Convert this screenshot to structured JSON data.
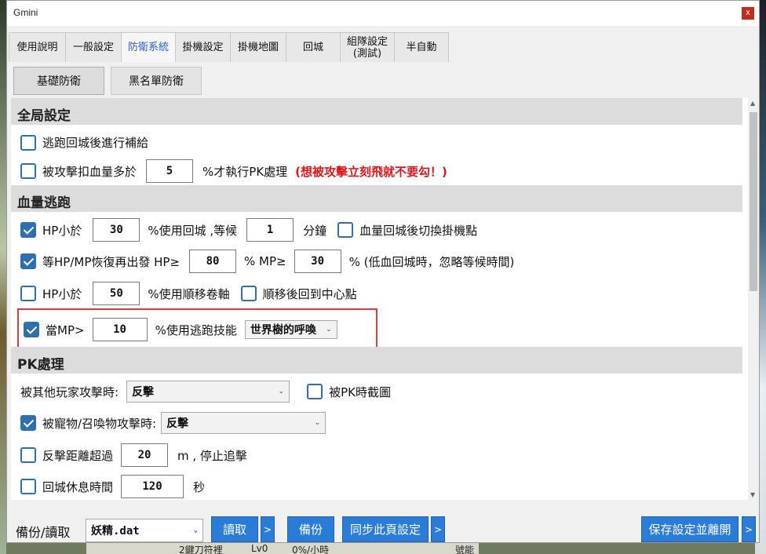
{
  "window": {
    "title": "Gmini",
    "close": "x"
  },
  "tabs": [
    {
      "label": "使用說明"
    },
    {
      "label": "一般設定"
    },
    {
      "label": "防衛系統"
    },
    {
      "label": "掛機設定"
    },
    {
      "label": "掛機地圖"
    },
    {
      "label": "回城"
    },
    {
      "label": "組隊設定\n(測試)"
    },
    {
      "label": "半自動"
    }
  ],
  "subtabs": [
    {
      "label": "基礎防衛"
    },
    {
      "label": "黑名單防衛"
    }
  ],
  "sections": {
    "global": "全局設定",
    "hp_escape": "血量逃跑",
    "pk": "PK處理"
  },
  "global": {
    "resupply": {
      "label": "逃跑回城後進行補給",
      "checked": false
    },
    "attacked": {
      "label": "被攻擊扣血量多於",
      "value": "5",
      "suffix": "%才執行PK處理",
      "warning": "(想被攻擊立刻飛就不要勾！)",
      "checked": false
    }
  },
  "hp": {
    "row1": {
      "label": "HP小於",
      "value": "30",
      "mid": "%使用回城 ,等候",
      "wait": "1",
      "unit": "分鐘",
      "switch_label": "血量回城後切換掛機點",
      "checked": true,
      "switch_checked": false
    },
    "row2": {
      "label": "等HP/MP恢復再出發 HP≥",
      "hp": "80",
      "mid": "%  MP≥",
      "mp": "30",
      "suffix": "% (低血回城時，忽略等候時間)",
      "checked": true
    },
    "row3": {
      "label": "HP小於",
      "value": "50",
      "mid": "%使用順移卷軸",
      "center_label": "順移後回到中心點",
      "checked": false,
      "center_checked": false
    },
    "row4": {
      "label": "當MP>",
      "value": "10",
      "mid": "%使用逃跑技能",
      "skill": "世界樹的呼喚",
      "checked": true
    }
  },
  "pk": {
    "player": {
      "label": "被其他玩家攻擊時:",
      "action": "反擊",
      "screenshot_label": "被PK時截圖",
      "screenshot_checked": false
    },
    "pet": {
      "label": "被寵物/召喚物攻擊時:",
      "action": "反擊",
      "checked": true
    },
    "distance": {
      "label": "反擊距離超過",
      "value": "20",
      "suffix": "m , 停止追擊",
      "checked": false
    },
    "rest": {
      "label": "回城休息時間",
      "value": "120",
      "suffix": "秒",
      "checked": false
    }
  },
  "bottom": {
    "label": "備份/讀取",
    "file": "妖精.dat",
    "read": "讀取",
    "more": ">",
    "backup": "備份",
    "sync": "同步此頁設定",
    "save": "保存設定並離開"
  },
  "background": {
    "t1": "2鍵刀符裡",
    "t2": "Lv0",
    "t3": "0%/小時",
    "t4": "號能"
  },
  "colors": {
    "accent": "#2b7cd6",
    "warning": "#e0141a",
    "highlight": "#e03a3a",
    "active_tab": "#2a5adb"
  }
}
